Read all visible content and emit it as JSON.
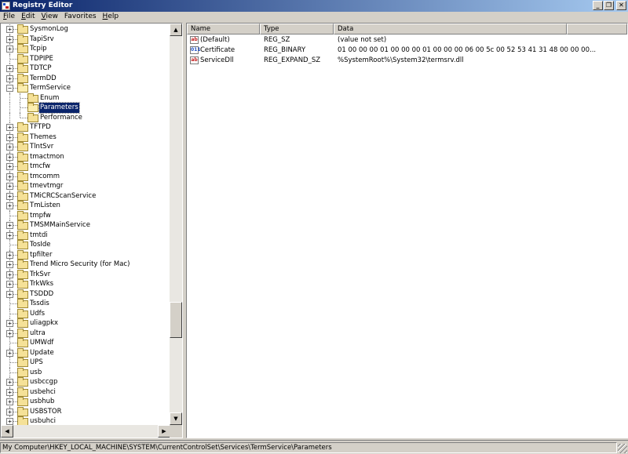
{
  "window": {
    "title": "Registry Editor",
    "controls": {
      "minimize": "_",
      "restore": "❐",
      "close": "✕"
    }
  },
  "menu": [
    {
      "label": "File",
      "access": "F",
      "rest": "ile"
    },
    {
      "label": "Edit",
      "access": "E",
      "rest": "dit"
    },
    {
      "label": "View",
      "access": "V",
      "rest": "iew"
    },
    {
      "label": "Favorites",
      "access": "",
      "rest": "Favorites"
    },
    {
      "label": "Help",
      "access": "H",
      "rest": "elp"
    }
  ],
  "tree": {
    "items": [
      {
        "label": "SysmonLog",
        "level": 0,
        "expander": "+"
      },
      {
        "label": "TapiSrv",
        "level": 0,
        "expander": "+"
      },
      {
        "label": "Tcpip",
        "level": 0,
        "expander": "+"
      },
      {
        "label": "TDPIPE",
        "level": 0,
        "expander": ""
      },
      {
        "label": "TDTCP",
        "level": 0,
        "expander": "+"
      },
      {
        "label": "TermDD",
        "level": 0,
        "expander": "+"
      },
      {
        "label": "TermService",
        "level": 0,
        "expander": "−",
        "open": true
      },
      {
        "label": "Enum",
        "level": 1,
        "expander": ""
      },
      {
        "label": "Parameters",
        "level": 1,
        "expander": "",
        "selected": true,
        "open": true
      },
      {
        "label": "Performance",
        "level": 1,
        "expander": "",
        "last": true
      },
      {
        "label": "TFTPD",
        "level": 0,
        "expander": "+"
      },
      {
        "label": "Themes",
        "level": 0,
        "expander": "+"
      },
      {
        "label": "TlntSvr",
        "level": 0,
        "expander": "+"
      },
      {
        "label": "tmactmon",
        "level": 0,
        "expander": "+"
      },
      {
        "label": "tmcfw",
        "level": 0,
        "expander": "+"
      },
      {
        "label": "tmcomm",
        "level": 0,
        "expander": "+"
      },
      {
        "label": "tmevtmgr",
        "level": 0,
        "expander": "+"
      },
      {
        "label": "TMiCRCScanService",
        "level": 0,
        "expander": "+"
      },
      {
        "label": "TmListen",
        "level": 0,
        "expander": "+"
      },
      {
        "label": "tmpfw",
        "level": 0,
        "expander": ""
      },
      {
        "label": "TMSMMainService",
        "level": 0,
        "expander": "+"
      },
      {
        "label": "tmtdi",
        "level": 0,
        "expander": "+"
      },
      {
        "label": "TosIde",
        "level": 0,
        "expander": ""
      },
      {
        "label": "tpfilter",
        "level": 0,
        "expander": "+"
      },
      {
        "label": "Trend Micro Security (for Mac)",
        "level": 0,
        "expander": "+"
      },
      {
        "label": "TrkSvr",
        "level": 0,
        "expander": "+"
      },
      {
        "label": "TrkWks",
        "level": 0,
        "expander": "+"
      },
      {
        "label": "TSDDD",
        "level": 0,
        "expander": "+"
      },
      {
        "label": "Tssdis",
        "level": 0,
        "expander": ""
      },
      {
        "label": "Udfs",
        "level": 0,
        "expander": ""
      },
      {
        "label": "uliagpkx",
        "level": 0,
        "expander": "+"
      },
      {
        "label": "ultra",
        "level": 0,
        "expander": "+"
      },
      {
        "label": "UMWdf",
        "level": 0,
        "expander": ""
      },
      {
        "label": "Update",
        "level": 0,
        "expander": "+"
      },
      {
        "label": "UPS",
        "level": 0,
        "expander": ""
      },
      {
        "label": "usb",
        "level": 0,
        "expander": ""
      },
      {
        "label": "usbccgp",
        "level": 0,
        "expander": "+"
      },
      {
        "label": "usbehci",
        "level": 0,
        "expander": "+"
      },
      {
        "label": "usbhub",
        "level": 0,
        "expander": "+"
      },
      {
        "label": "USBSTOR",
        "level": 0,
        "expander": "+"
      },
      {
        "label": "usbuhci",
        "level": 0,
        "expander": "+"
      },
      {
        "label": "",
        "level": 0,
        "expander": "+"
      }
    ],
    "scroll": {
      "up": "▲",
      "down": "▼",
      "left": "◀",
      "right": "▶",
      "thumb_position": 0.78
    }
  },
  "list": {
    "columns": [
      "Name",
      "Type",
      "Data"
    ],
    "rows": [
      {
        "icon": "ab",
        "icon_kind": "string-value-icon",
        "name": "(Default)",
        "type": "REG_SZ",
        "data": "(value not set)"
      },
      {
        "icon": "011",
        "icon_kind": "binary-value-icon",
        "name": "Certificate",
        "type": "REG_BINARY",
        "data": "01 00 00 00 01 00 00 00 01 00 00 00 06 00 5c 00 52 53 41 31 48 00 00 00..."
      },
      {
        "icon": "ab",
        "icon_kind": "string-value-icon",
        "name": "ServiceDll",
        "type": "REG_EXPAND_SZ",
        "data": "%SystemRoot%\\System32\\termsrv.dll"
      }
    ]
  },
  "status": {
    "path": "My Computer\\HKEY_LOCAL_MACHINE\\SYSTEM\\CurrentControlSet\\Services\\TermService\\Parameters"
  },
  "colors": {
    "title_start": "#0a246a",
    "title_end": "#a6caf0",
    "selection": "#0a246a",
    "face": "#d4d0c8",
    "folder": "#f5e197"
  }
}
